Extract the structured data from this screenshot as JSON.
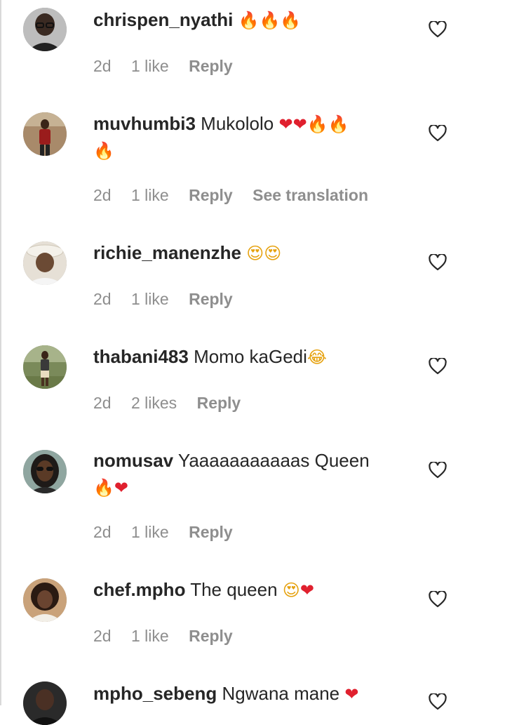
{
  "comments": [
    {
      "username": "chrispen_nyathi",
      "text": "",
      "emojis": [
        {
          "glyph": "🔥",
          "kind": "fire"
        },
        {
          "glyph": "🔥",
          "kind": "fire"
        },
        {
          "glyph": "🔥",
          "kind": "fire"
        }
      ],
      "continuation": [],
      "time": "2d",
      "likes": "1 like",
      "reply": "Reply",
      "translation": "",
      "avatar_icon": "avatar-man-glasses-icon"
    },
    {
      "username": "muvhumbi3",
      "text": "Mukololo",
      "emojis": [
        {
          "glyph": "❤",
          "kind": "heart"
        },
        {
          "glyph": "❤",
          "kind": "heart"
        },
        {
          "glyph": "🔥",
          "kind": "fire"
        },
        {
          "glyph": "🔥",
          "kind": "fire"
        }
      ],
      "continuation": [
        {
          "glyph": "🔥",
          "kind": "fire"
        }
      ],
      "time": "2d",
      "likes": "1 like",
      "reply": "Reply",
      "translation": "See translation",
      "avatar_icon": "avatar-man-red-shirt-icon"
    },
    {
      "username": "richie_manenzhe",
      "text": "",
      "emojis": [
        {
          "glyph": "😍",
          "kind": "face"
        },
        {
          "glyph": "😍",
          "kind": "face"
        }
      ],
      "continuation": [],
      "time": "2d",
      "likes": "1 like",
      "reply": "Reply",
      "translation": "",
      "avatar_icon": "avatar-man-hat-icon"
    },
    {
      "username": "thabani483",
      "text": "Momo kaGedi",
      "emojis": [
        {
          "glyph": "😂",
          "kind": "face"
        }
      ],
      "continuation": [],
      "time": "2d",
      "likes": "2 likes",
      "reply": "Reply",
      "translation": "",
      "avatar_icon": "avatar-man-outdoors-icon"
    },
    {
      "username": "nomusav",
      "text": "Yaaaaaaaaaaas Queen",
      "emojis": [],
      "continuation": [
        {
          "glyph": "🔥",
          "kind": "fire"
        },
        {
          "glyph": "❤",
          "kind": "heart"
        }
      ],
      "time": "2d",
      "likes": "1 like",
      "reply": "Reply",
      "translation": "",
      "avatar_icon": "avatar-woman-sunglasses-icon"
    },
    {
      "username": "chef.mpho",
      "text": "The queen",
      "emojis": [
        {
          "glyph": "😍",
          "kind": "face"
        },
        {
          "glyph": "❤",
          "kind": "heart"
        }
      ],
      "continuation": [],
      "time": "2d",
      "likes": "1 like",
      "reply": "Reply",
      "translation": "",
      "avatar_icon": "avatar-woman-curly-hair-icon"
    },
    {
      "username": "mpho_sebeng",
      "text": "Ngwana mane",
      "emojis": [
        {
          "glyph": "❤",
          "kind": "heart"
        }
      ],
      "continuation": [],
      "time": "",
      "likes": "",
      "reply": "",
      "translation": "",
      "avatar_icon": "avatar-man-dark-icon"
    }
  ],
  "colors": {
    "text": "#262626",
    "meta": "#8e8e8e",
    "fire": "#f06a1a",
    "heart": "#e0202e",
    "face": "#e6a210"
  },
  "like_icon": "heart-outline-icon"
}
